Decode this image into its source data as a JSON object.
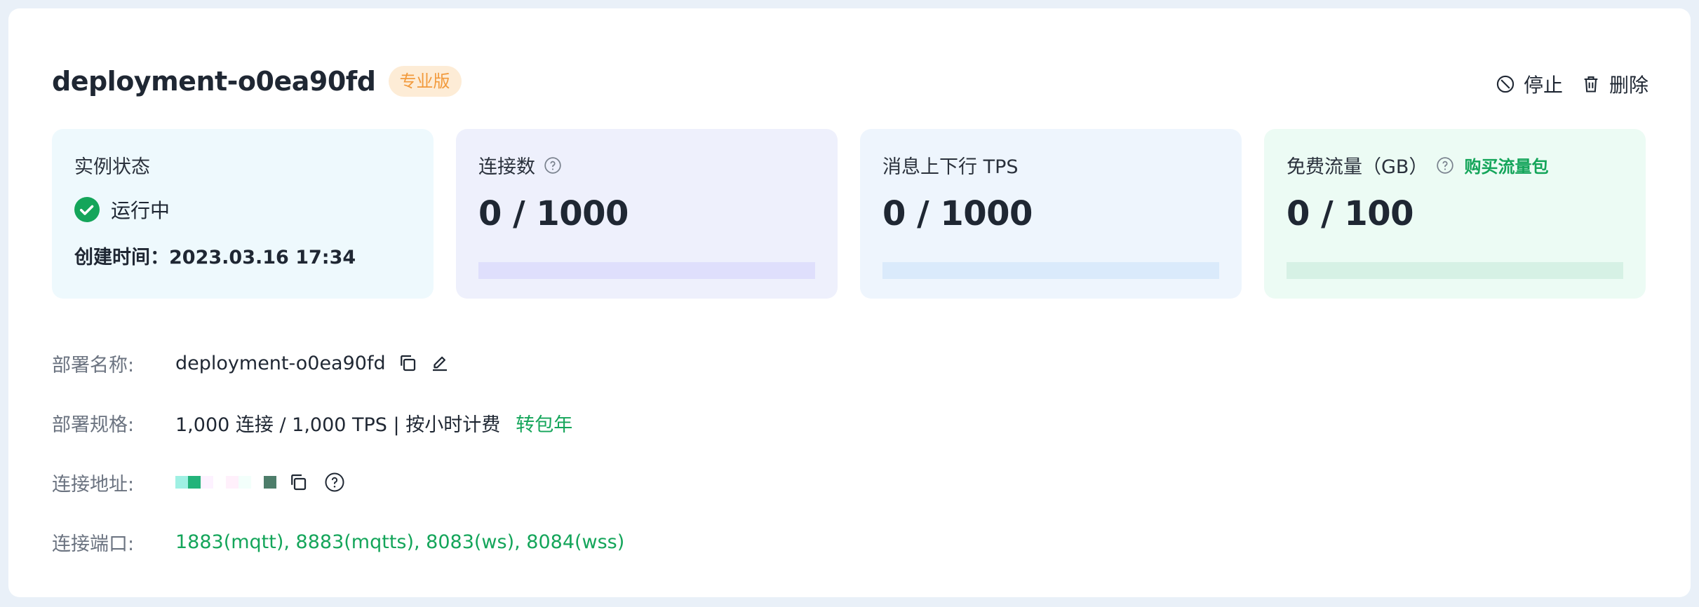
{
  "header": {
    "title": "deployment-o0ea90fd",
    "badge": "专业版",
    "actions": {
      "stop": "停止",
      "delete": "删除"
    }
  },
  "stats": {
    "status": {
      "label": "实例状态",
      "value": "运行中",
      "created_label": "创建时间：",
      "created_value": "2023.03.16 17:34"
    },
    "connections": {
      "label": "连接数",
      "value": "0 / 1000",
      "fraction": 0
    },
    "tps": {
      "label": "消息上下行 TPS",
      "value": "0 / 1000",
      "fraction": 0
    },
    "traffic": {
      "label": "免费流量（GB）",
      "buy_link": "购买流量包",
      "value": "0 / 100",
      "fraction": 0
    }
  },
  "details": {
    "name": {
      "label": "部署名称:",
      "value": "deployment-o0ea90fd"
    },
    "spec": {
      "label": "部署规格:",
      "value": "1,000 连接 / 1,000 TPS | 按小时计费",
      "link": "转包年"
    },
    "address": {
      "label": "连接地址:"
    },
    "ports": {
      "label": "连接端口:",
      "value": "1883(mqtt), 8883(mqtts), 8083(ws), 8084(wss)"
    }
  },
  "icons": {
    "stop": "ban-icon",
    "delete": "trash-icon",
    "status": "check-circle-icon",
    "help": "question-circle-icon",
    "copy": "copy-icon",
    "edit": "edit-icon"
  },
  "colors": {
    "accent_green": "#14a55a",
    "badge_bg": "#fdecd6",
    "badge_text": "#f29a3c",
    "status_card_bg": "#eef9fd",
    "connections_card_bg": "#eef0fc",
    "tps_card_bg": "#eef5fd",
    "traffic_card_bg": "#ecfbf4"
  }
}
